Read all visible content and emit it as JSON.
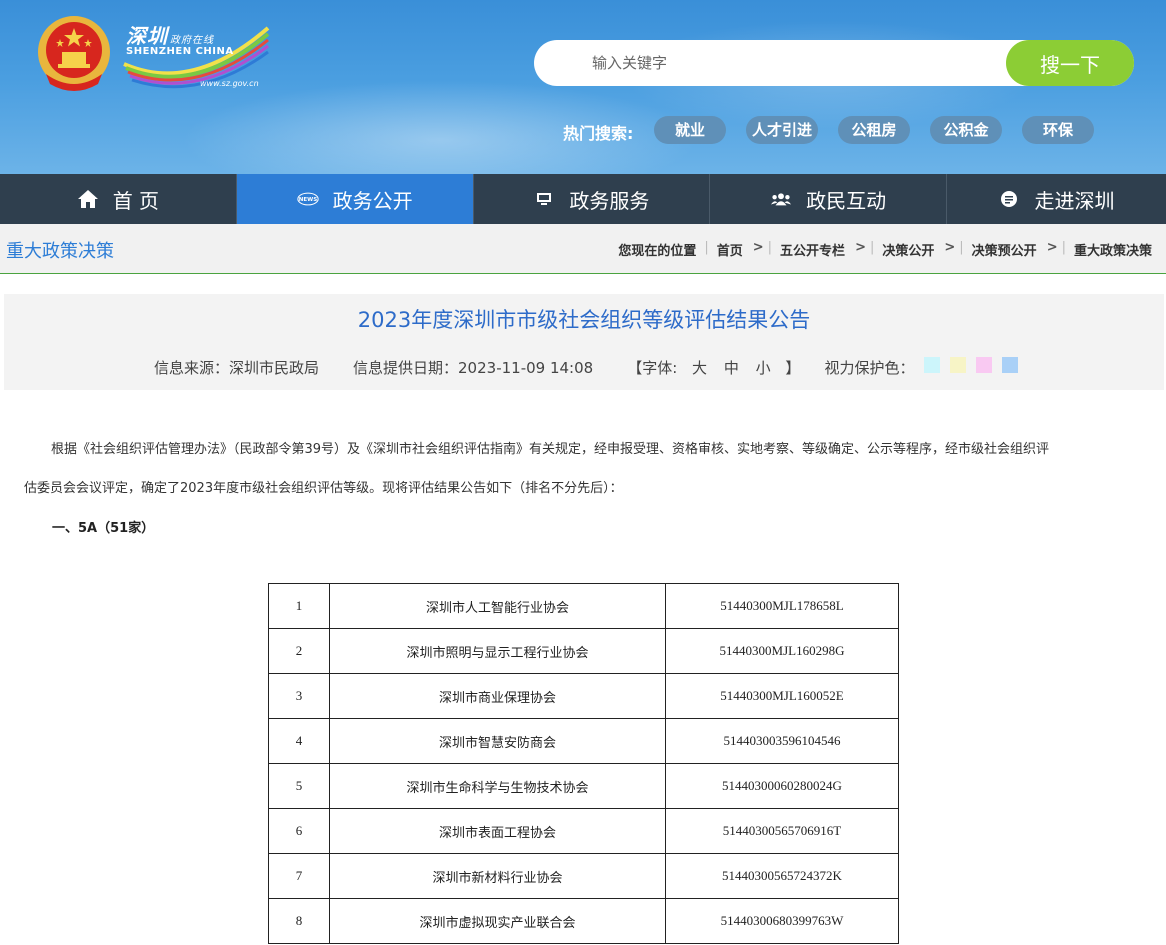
{
  "header": {
    "logo_cn": "深圳",
    "logo_cn_small": "政府在线",
    "logo_en": "SHENZHEN CHINA",
    "logo_url": "www.sz.gov.cn",
    "search_placeholder": "输入关键字",
    "search_button": "搜一下",
    "hot_label": "热门搜索:",
    "hot_tags": [
      "就业",
      "人才引进",
      "公租房",
      "公积金",
      "环保"
    ]
  },
  "nav": {
    "items": [
      {
        "label": "首 页",
        "icon": "home-icon"
      },
      {
        "label": "政务公开",
        "icon": "news-icon"
      },
      {
        "label": "政务服务",
        "icon": "monitor-icon"
      },
      {
        "label": "政民互动",
        "icon": "people-icon"
      },
      {
        "label": "走进深圳",
        "icon": "info-bubble-icon"
      }
    ],
    "active_index": 1
  },
  "breadcrumb": {
    "section_title": "重大政策决策",
    "location_label": "您现在的位置",
    "items": [
      "首页",
      "五公开专栏",
      "决策公开",
      "决策预公开",
      "重大政策决策"
    ]
  },
  "article": {
    "title": "2023年度深圳市市级社会组织等级评估结果公告",
    "source": "信息来源：深圳市民政局",
    "date": "信息提供日期：2023-11-09 14:08",
    "font_label": "【字体:",
    "font_large": "大",
    "font_medium": "中",
    "font_small": "小",
    "font_end": "】",
    "eye_label": "视力保护色：",
    "eye_colors": [
      "#ccf5fb",
      "#f7f4c6",
      "#f9c9f2",
      "#a9d0f7"
    ],
    "para_line1": "根据《社会组织评估管理办法》（民政部令第39号）及《深圳市社会组织评估指南》有关规定，经申报受理、资格审核、实地考察、等级确定、公示等程序，经市级社会组织评",
    "para_line2": "估委员会会议评定，确定了2023年度市级社会组织评估等级。现将评估结果公告如下（排名不分先后）：",
    "subheading": "一、5A（51家）"
  },
  "table": {
    "rows": [
      [
        "1",
        "深圳市人工智能行业协会",
        "51440300MJL178658L"
      ],
      [
        "2",
        "深圳市照明与显示工程行业协会",
        "51440300MJL160298G"
      ],
      [
        "3",
        "深圳市商业保理协会",
        "51440300MJL160052E"
      ],
      [
        "4",
        "深圳市智慧安防商会",
        "514403003596104546"
      ],
      [
        "5",
        "深圳市生命科学与生物技术协会",
        "51440300060280024G"
      ],
      [
        "6",
        "深圳市表面工程协会",
        "51440300565706916T"
      ],
      [
        "7",
        "深圳市新材料行业协会",
        "51440300565724372K"
      ],
      [
        "8",
        "深圳市虚拟现实产业联合会",
        "51440300680399763W"
      ]
    ]
  }
}
